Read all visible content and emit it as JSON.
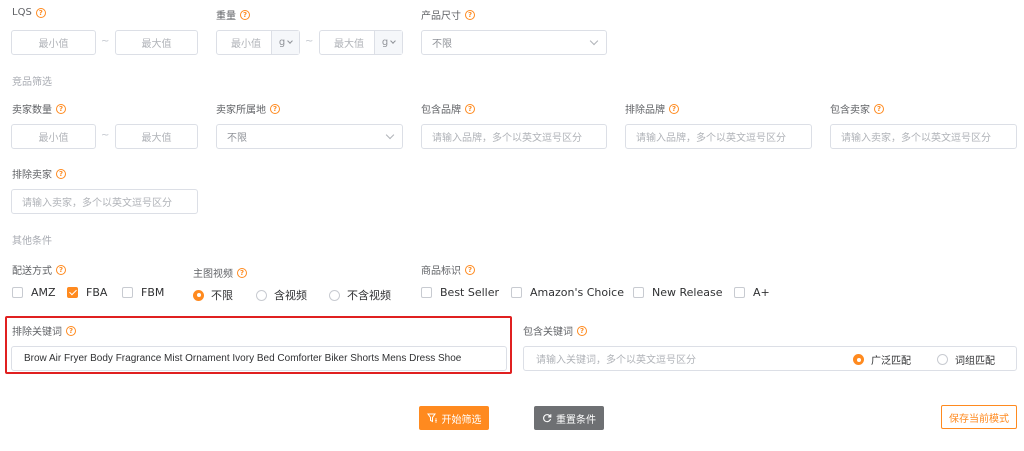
{
  "filters": {
    "lqs": {
      "label": "LQS",
      "min_placeholder": "最小值",
      "max_placeholder": "最大值"
    },
    "weight": {
      "label": "重量",
      "min_placeholder": "最小值",
      "max_placeholder": "最大值",
      "unit": "g"
    },
    "size": {
      "label": "产品尺寸",
      "value": "不限"
    }
  },
  "competitor": {
    "section_title": "竞品筛选",
    "seller_count": {
      "label": "卖家数量",
      "min_placeholder": "最小值",
      "max_placeholder": "最大值"
    },
    "seller_location": {
      "label": "卖家所属地",
      "value": "不限"
    },
    "include_brand": {
      "label": "包含品牌",
      "placeholder": "请输入品牌，多个以英文逗号区分"
    },
    "exclude_brand": {
      "label": "排除品牌",
      "placeholder": "请输入品牌，多个以英文逗号区分"
    },
    "include_seller": {
      "label": "包含卖家",
      "placeholder": "请输入卖家，多个以英文逗号区分"
    },
    "exclude_seller": {
      "label": "排除卖家",
      "placeholder": "请输入卖家，多个以英文逗号区分"
    }
  },
  "other": {
    "section_title": "其他条件",
    "shipping": {
      "label": "配送方式",
      "options": [
        "AMZ",
        "FBA",
        "FBM"
      ],
      "checked": [
        false,
        true,
        false
      ]
    },
    "video": {
      "label": "主图视频",
      "options": [
        "不限",
        "含视频",
        "不含视频"
      ],
      "selected": 0
    },
    "badge": {
      "label": "商品标识",
      "options": [
        "Best Seller",
        "Amazon's Choice",
        "New Release",
        "A+"
      ]
    }
  },
  "keywords": {
    "exclude": {
      "label": "排除关键词",
      "value": "Brow Air Fryer Body Fragrance Mist Ornament Ivory Bed Comforter Biker Shorts Mens Dress Shoe"
    },
    "include": {
      "label": "包含关键词",
      "placeholder": "请输入关键词，多个以英文逗号区分",
      "match_options": [
        "广泛匹配",
        "词组匹配"
      ],
      "match_selected": 0
    }
  },
  "actions": {
    "start": "开始筛选",
    "reset": "重置条件",
    "save": "保存当前模式"
  },
  "colors": {
    "accent": "#ff8a1f",
    "highlight_border": "#e02020",
    "reset_bg": "#6e7073"
  }
}
